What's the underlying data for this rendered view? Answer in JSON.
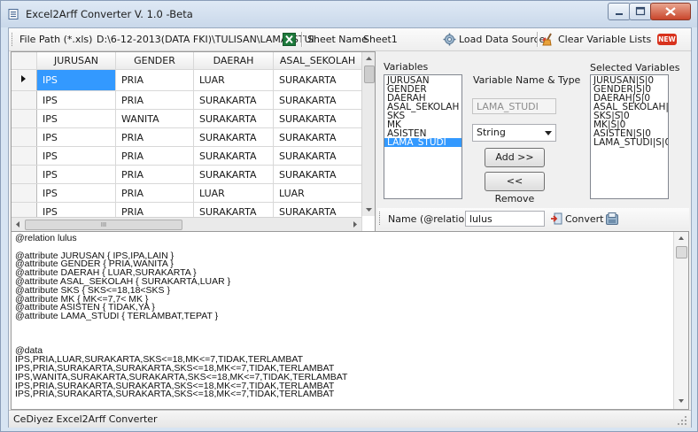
{
  "window": {
    "title": "Excel2Arff Converter  V. 1.0 -Beta"
  },
  "toolbar": {
    "file_path_label": "File Path (*.xls)",
    "file_path_value": "D:\\6-12-2013(DATA FKI)\\TULISAN\\LAMA_STUI",
    "sheet_name_label": "Sheet Name",
    "sheet_name_value": "Sheet1",
    "load_label": "Load Data Source",
    "clear_label": "Clear Variable Lists",
    "new_badge": "NEW"
  },
  "grid": {
    "columns": [
      "JURUSAN",
      "GENDER",
      "DAERAH",
      "ASAL_SEKOLAH"
    ],
    "rows": [
      [
        "IPS",
        "PRIA",
        "LUAR",
        "SURAKARTA"
      ],
      [
        "IPS",
        "PRIA",
        "SURAKARTA",
        "SURAKARTA"
      ],
      [
        "IPS",
        "WANITA",
        "SURAKARTA",
        "SURAKARTA"
      ],
      [
        "IPS",
        "PRIA",
        "SURAKARTA",
        "SURAKARTA"
      ],
      [
        "IPS",
        "PRIA",
        "SURAKARTA",
        "SURAKARTA"
      ],
      [
        "IPS",
        "PRIA",
        "SURAKARTA",
        "SURAKARTA"
      ],
      [
        "IPS",
        "PRIA",
        "LUAR",
        "LUAR"
      ],
      [
        "IPS",
        "PRIA",
        "SURAKARTA",
        "SURAKARTA"
      ],
      [
        "IPS",
        "WANITA",
        "SURAKARTA",
        "SURAKARTA"
      ]
    ],
    "hscroll_glyph": "III"
  },
  "variables": {
    "label": "Variables",
    "items": [
      "JURUSAN",
      "GENDER",
      "DAERAH",
      "ASAL_SEKOLAH",
      "SKS",
      "MK",
      "ASISTEN",
      "LAMA_STUDI"
    ],
    "selected_index": 7
  },
  "name_type": {
    "label": "Variable Name & Type",
    "name_value": "LAMA_STUDI",
    "type_value": "String",
    "add_label": "Add >>",
    "remove_label": "<< Remove"
  },
  "selected_vars": {
    "label": "Selected Variables",
    "items": [
      "JURUSAN|S|0",
      "GENDER|S|0",
      "DAERAH|S|0",
      "ASAL_SEKOLAH|S|",
      "SKS|S|0",
      "MK|S|0",
      "ASISTEN|S|0",
      "LAMA_STUDI|S|0"
    ]
  },
  "relation": {
    "label": "Name (@relation)",
    "value": "lulus",
    "convert_label": "Convert"
  },
  "output": {
    "text": "@relation lulus\n\n@attribute JURUSAN { IPS,IPA,LAIN }\n@attribute GENDER { PRIA,WANITA }\n@attribute DAERAH { LUAR,SURAKARTA }\n@attribute ASAL_SEKOLAH { SURAKARTA,LUAR }\n@attribute SKS { SKS<=18,18<SKS }\n@attribute MK { MK<=7,7< MK }\n@attribute ASISTEN { TIDAK,YA }\n@attribute LAMA_STUDI { TERLAMBAT,TEPAT }\n\n\n\n@data\nIPS,PRIA,LUAR,SURAKARTA,SKS<=18,MK<=7,TIDAK,TERLAMBAT\nIPS,PRIA,SURAKARTA,SURAKARTA,SKS<=18,MK<=7,TIDAK,TERLAMBAT\nIPS,WANITA,SURAKARTA,SURAKARTA,SKS<=18,MK<=7,TIDAK,TERLAMBAT\nIPS,PRIA,SURAKARTA,SURAKARTA,SKS<=18,MK<=7,TIDAK,TERLAMBAT\nIPS,PRIA,SURAKARTA,SURAKARTA,SKS<=18,MK<=7,TIDAK,TERLAMBAT"
  },
  "status": {
    "text": "CeDiyez Excel2Arff Converter"
  },
  "colors": {
    "selection": "#3399ff",
    "title_bar": "#c9d8ea",
    "close_button": "#c9462c"
  }
}
